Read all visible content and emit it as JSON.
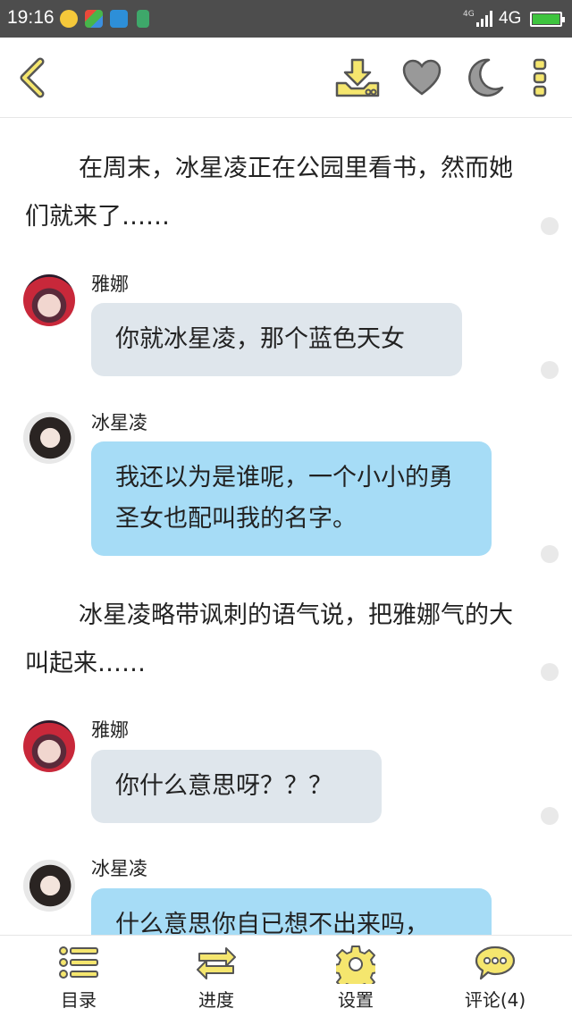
{
  "status_bar": {
    "time": "19:16",
    "network_type": "4G",
    "network_small": "4G"
  },
  "toolbar": {
    "back_icon": "chevron-left-icon",
    "download_icon": "download-icon",
    "like_icon": "heart-icon",
    "night_mode_icon": "moon-icon",
    "more_icon": "more-vertical-icon",
    "accent_color": "#f5e66e"
  },
  "story": {
    "paragraph_1": "在周末，冰星凌正在公园里看书，然而她们就来了……",
    "message_1": {
      "speaker": "雅娜",
      "text": "你就冰星凌，那个蓝色天女"
    },
    "message_2": {
      "speaker": "冰星凌",
      "text": "我还以为是谁呢，一个小小的勇圣女也配叫我的名字。"
    },
    "paragraph_2": "冰星凌略带讽刺的语气说，把雅娜气的大叫起来……",
    "message_3": {
      "speaker": "雅娜",
      "text": "你什么意思呀？？？"
    },
    "message_4": {
      "speaker": "冰星凌",
      "text": "什么意思你自已想不出来吗，"
    }
  },
  "colors": {
    "bubble_gray": "#dfe6ec",
    "bubble_blue": "#a6dcf6"
  },
  "bottom_nav": {
    "toc": "目录",
    "progress": "进度",
    "settings": "设置",
    "comments": "评论(4)"
  }
}
